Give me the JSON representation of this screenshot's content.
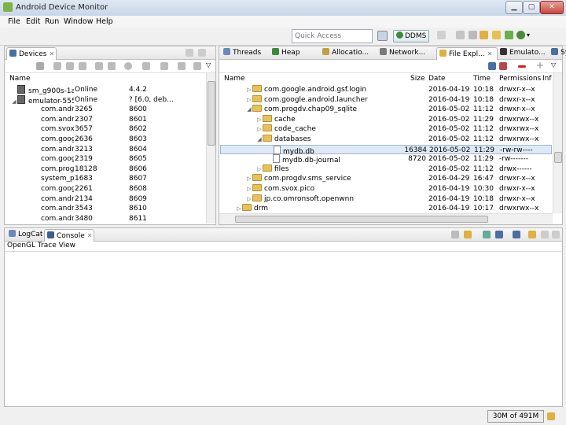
{
  "window": {
    "title": "Android Device Monitor"
  },
  "menu": [
    {
      "label": "File",
      "key": "F"
    },
    {
      "label": "Edit",
      "key": "E"
    },
    {
      "label": "Run",
      "key": "R"
    },
    {
      "label": "Window",
      "key": "W"
    },
    {
      "label": "Help",
      "key": "H"
    }
  ],
  "toolbar": {
    "quick_access_placeholder": "Quick Access",
    "perspective_label": "DDMS"
  },
  "devices": {
    "tab_label": "Devices",
    "header": "Name",
    "rows": [
      {
        "name": "sm_g900s-1a",
        "status": "Online",
        "ver": "4.4.2",
        "level": 0
      },
      {
        "name": "emulator-555",
        "status": "Online",
        "ver": "? [6.0, deb...",
        "level": 0
      },
      {
        "name": "com.andr",
        "status": "3265",
        "ver": "8600",
        "level": 1
      },
      {
        "name": "com.andr",
        "status": "2307",
        "ver": "8601",
        "level": 1
      },
      {
        "name": "com.svox.",
        "status": "3657",
        "ver": "8602",
        "level": 1
      },
      {
        "name": "com.goog",
        "status": "2636",
        "ver": "8603",
        "level": 1
      },
      {
        "name": "com.andr",
        "status": "3213",
        "ver": "8604",
        "level": 1
      },
      {
        "name": "com.goog",
        "status": "2319",
        "ver": "8605",
        "level": 1
      },
      {
        "name": "com.progr",
        "status": "18128",
        "ver": "8606",
        "level": 1
      },
      {
        "name": "system_pr",
        "status": "1683",
        "ver": "8607",
        "level": 1
      },
      {
        "name": "com.goog",
        "status": "2261",
        "ver": "8608",
        "level": 1
      },
      {
        "name": "com.andr",
        "status": "2134",
        "ver": "8609",
        "level": 1
      },
      {
        "name": "com.andr",
        "status": "3543",
        "ver": "8610",
        "level": 1
      },
      {
        "name": "com.andr",
        "status": "3480",
        "ver": "8611",
        "level": 1
      }
    ]
  },
  "right_tabs": [
    "Threads",
    "Heap",
    "Allocatio...",
    "Network...",
    "File Expl...",
    "Emulato...",
    "System I..."
  ],
  "file_explorer": {
    "headers": {
      "name": "Name",
      "size": "Size",
      "date": "Date",
      "time": "Time",
      "perm": "Permissions",
      "info": "Inf"
    },
    "rows": [
      {
        "name": "com.google.android.gsf.login",
        "size": "",
        "date": "2016-04-19",
        "time": "10:18",
        "perm": "drwxr-x--x",
        "indent": 1,
        "type": "folder",
        "arrow": "▷"
      },
      {
        "name": "com.google.android.launcher",
        "size": "",
        "date": "2016-04-19",
        "time": "10:18",
        "perm": "drwxr-x--x",
        "indent": 1,
        "type": "folder",
        "arrow": "▷"
      },
      {
        "name": "com.progdv.chap09_sqlite",
        "size": "",
        "date": "2016-05-02",
        "time": "11:12",
        "perm": "drwxr-x--x",
        "indent": 1,
        "type": "folder",
        "arrow": "◢"
      },
      {
        "name": "cache",
        "size": "",
        "date": "2016-05-02",
        "time": "11:29",
        "perm": "drwxrwx--x",
        "indent": 2,
        "type": "folder",
        "arrow": "▷"
      },
      {
        "name": "code_cache",
        "size": "",
        "date": "2016-05-02",
        "time": "11:12",
        "perm": "drwxrwx--x",
        "indent": 2,
        "type": "folder",
        "arrow": "▷"
      },
      {
        "name": "databases",
        "size": "",
        "date": "2016-05-02",
        "time": "11:12",
        "perm": "drwxrwx--x",
        "indent": 2,
        "type": "folder",
        "arrow": "◢"
      },
      {
        "name": "mydb.db",
        "size": "16384",
        "date": "2016-05-02",
        "time": "11:29",
        "perm": "-rw-rw----",
        "indent": 3,
        "type": "file",
        "arrow": ""
      },
      {
        "name": "mydb.db-journal",
        "size": "8720",
        "date": "2016-05-02",
        "time": "11:29",
        "perm": "-rw-------",
        "indent": 3,
        "type": "file",
        "arrow": ""
      },
      {
        "name": "files",
        "size": "",
        "date": "2016-05-02",
        "time": "11:12",
        "perm": "drwx------",
        "indent": 2,
        "type": "folder",
        "arrow": "▷"
      },
      {
        "name": "com.progdv.sms_service",
        "size": "",
        "date": "2016-04-29",
        "time": "16:47",
        "perm": "drwxr-x--x",
        "indent": 1,
        "type": "folder",
        "arrow": "▷"
      },
      {
        "name": "com.svox.pico",
        "size": "",
        "date": "2016-04-19",
        "time": "10:30",
        "perm": "drwxr-x--x",
        "indent": 1,
        "type": "folder",
        "arrow": "▷"
      },
      {
        "name": "jp.co.omronsoft.openwnn",
        "size": "",
        "date": "2016-04-19",
        "time": "10:18",
        "perm": "drwxr-x--x",
        "indent": 1,
        "type": "folder",
        "arrow": "▷"
      },
      {
        "name": "drm",
        "size": "",
        "date": "2016-04-19",
        "time": "10:17",
        "perm": "drwxrwx--x",
        "indent": 0,
        "type": "folder",
        "arrow": "▷"
      }
    ]
  },
  "bottom": {
    "tabs": [
      "LogCat",
      "Console"
    ],
    "console_title": "OpenGL Trace View"
  },
  "status": {
    "memory": "30M of 491M"
  }
}
